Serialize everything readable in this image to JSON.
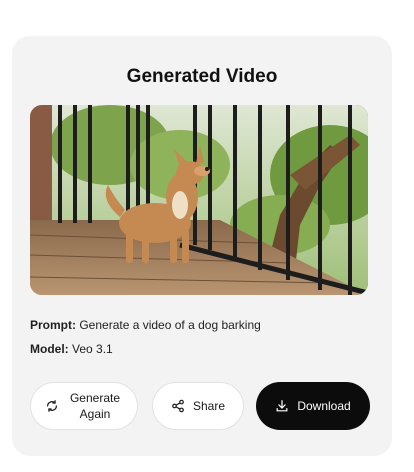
{
  "card": {
    "title": "Generated Video"
  },
  "video": {
    "description_icon": "video-thumbnail"
  },
  "meta": {
    "prompt_label": "Prompt:",
    "prompt_value": "Generate a video of a dog barking",
    "model_label": "Model:",
    "model_value": "Veo 3.1"
  },
  "actions": {
    "regenerate_label": "Generate Again",
    "regenerate_icon": "refresh-icon",
    "share_label": "Share",
    "share_icon": "share-icon",
    "download_label": "Download",
    "download_icon": "download-icon"
  },
  "colors": {
    "card_bg": "#f3f3f3",
    "primary_button": "#0c0c0c",
    "secondary_button": "#ffffff"
  }
}
